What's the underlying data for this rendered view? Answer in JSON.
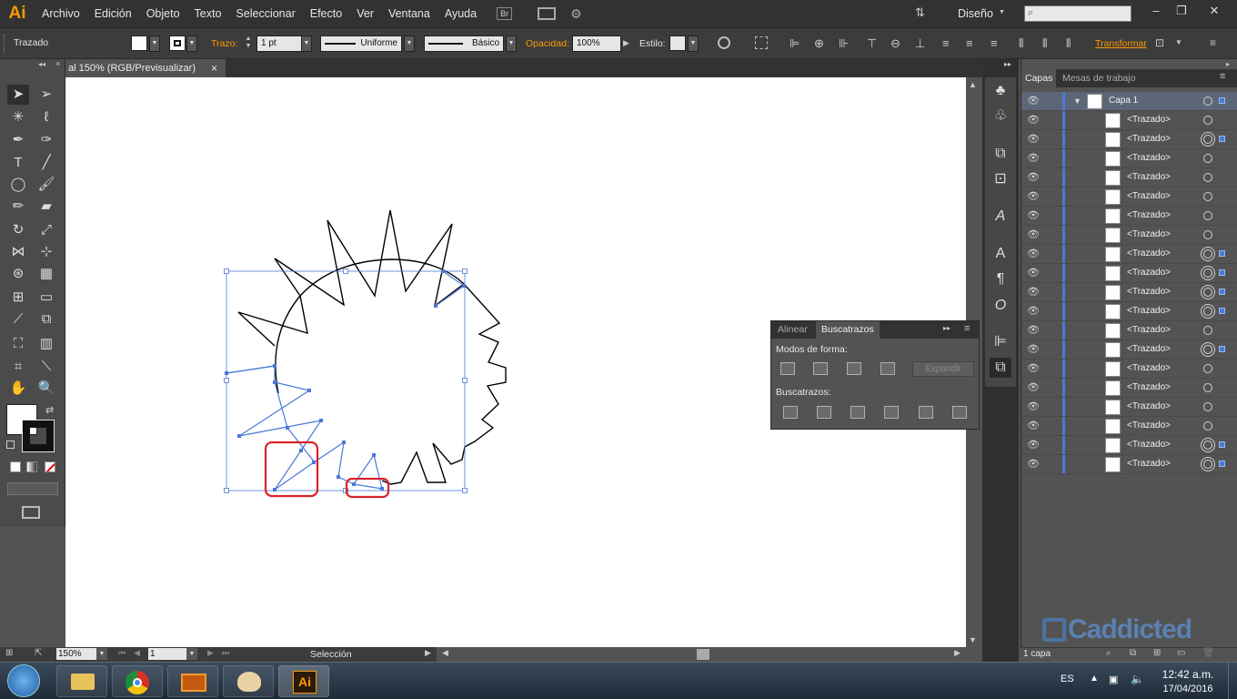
{
  "menubar": {
    "app_logo": "Ai",
    "items": [
      "Archivo",
      "Edición",
      "Objeto",
      "Texto",
      "Seleccionar",
      "Efecto",
      "Ver",
      "Ventana",
      "Ayuda"
    ],
    "bridge_label": "Br",
    "workspace": "Diseño",
    "search_placeholder": ""
  },
  "controlbar": {
    "object_type": "Trazado",
    "stroke_label": "Trazo:",
    "stroke_weight": "1 pt",
    "profile": "Uniforme",
    "brush": "Básico",
    "opacity_label": "Opacidad:",
    "opacity_value": "100%",
    "style_label": "Estilo:",
    "transform_label": "Transformar"
  },
  "document": {
    "tab_title": "al 150% (RGB/Previsualizar)",
    "close_glyph": "×"
  },
  "statusbar": {
    "zoom": "150%",
    "artboard_number": "1",
    "tool_status": "Selección"
  },
  "layers_panel": {
    "tabs": [
      "Capas",
      "Mesas de trabajo"
    ],
    "layer_name": "Capa 1",
    "footer_count": "1 capa",
    "rows": [
      {
        "name": "<Trazado>",
        "selected": false
      },
      {
        "name": "<Trazado>",
        "selected": true
      },
      {
        "name": "<Trazado>",
        "selected": false
      },
      {
        "name": "<Trazado>",
        "selected": false
      },
      {
        "name": "<Trazado>",
        "selected": false
      },
      {
        "name": "<Trazado>",
        "selected": false
      },
      {
        "name": "<Trazado>",
        "selected": false
      },
      {
        "name": "<Trazado>",
        "selected": true
      },
      {
        "name": "<Trazado>",
        "selected": true
      },
      {
        "name": "<Trazado>",
        "selected": true
      },
      {
        "name": "<Trazado>",
        "selected": true
      },
      {
        "name": "<Trazado>",
        "selected": false
      },
      {
        "name": "<Trazado>",
        "selected": true
      },
      {
        "name": "<Trazado>",
        "selected": false
      },
      {
        "name": "<Trazado>",
        "selected": false
      },
      {
        "name": "<Trazado>",
        "selected": false
      },
      {
        "name": "<Trazado>",
        "selected": false
      },
      {
        "name": "<Trazado>",
        "selected": true
      },
      {
        "name": "<Trazado>",
        "selected": true
      }
    ]
  },
  "pathfinder_panel": {
    "tabs": [
      "Alinear",
      "Buscatrazos"
    ],
    "shape_modes_label": "Modos de forma:",
    "pathfinders_label": "Buscatrazos:",
    "expand_button": "Expandir"
  },
  "watermark": "Caddicted",
  "taskbar": {
    "language": "ES",
    "time": "12:42 a.m.",
    "date": "17/04/2016"
  },
  "colors": {
    "accent_orange": "#ff9a00",
    "selection_blue": "#4a79d6",
    "highlight_red": "#d9222a"
  }
}
